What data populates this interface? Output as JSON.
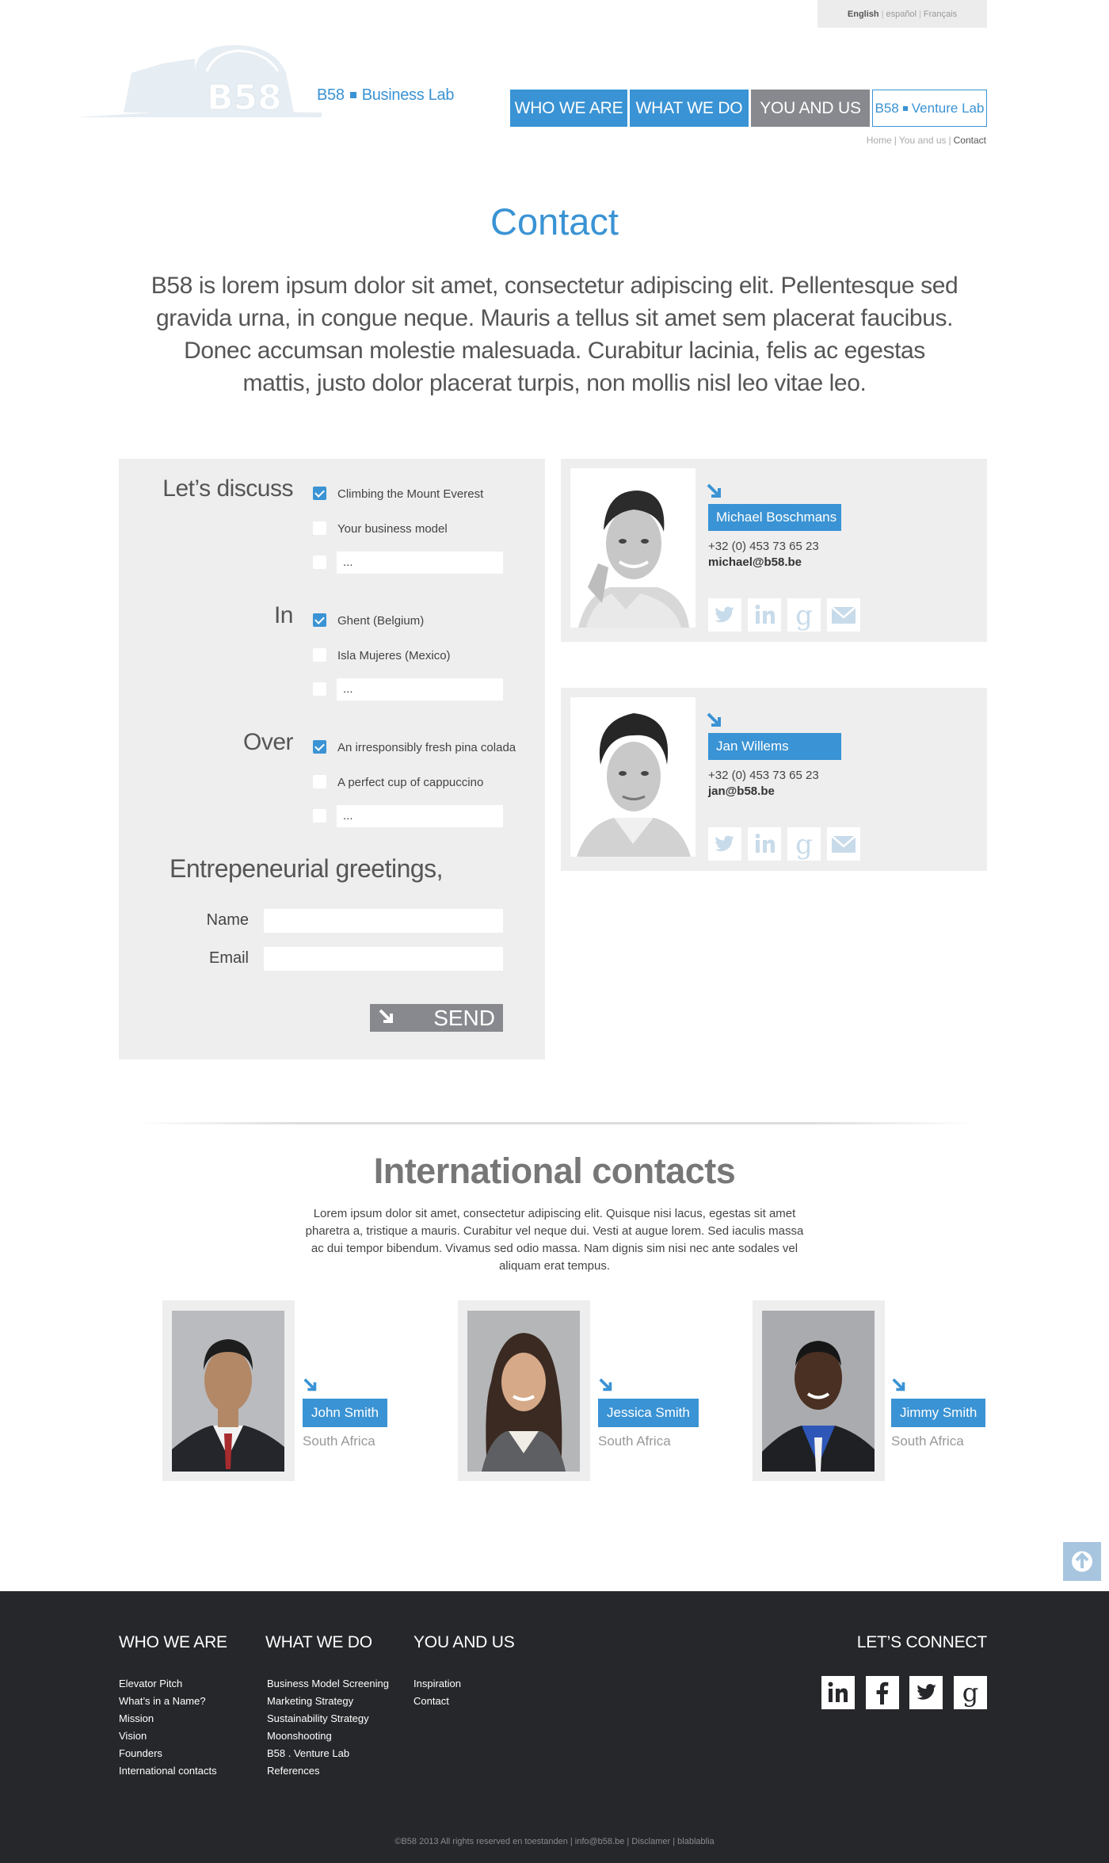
{
  "languages": {
    "current": "English",
    "other": [
      "español",
      "Français"
    ]
  },
  "logo": {
    "mark": "B58",
    "name": "B58",
    "suffix": "Business Lab"
  },
  "nav": {
    "items": [
      "WHO WE ARE",
      "WHAT WE DO",
      "YOU AND US"
    ],
    "active": "YOU AND US",
    "venture": {
      "name": "B58",
      "suffix": "Venture Lab"
    }
  },
  "breadcrumb": [
    "Home",
    "You and us",
    "Contact"
  ],
  "page": {
    "title": "Contact",
    "intro": "B58 is lorem ipsum dolor sit amet, consectetur adipiscing elit. Pellentesque sed gravida urna, in congue neque. Mauris a tellus sit amet sem placerat faucibus. Donec accumsan molestie malesuada. Curabitur lacinia, felis ac egestas mattis, justo dolor placerat turpis, non mollis nisl leo vitae leo."
  },
  "form": {
    "groups": [
      {
        "label": "Let’s discuss",
        "options": [
          {
            "text": "Climbing the Mount Everest",
            "checked": true
          },
          {
            "text": "Your business model",
            "checked": false
          }
        ],
        "custom": "..."
      },
      {
        "label": "In",
        "options": [
          {
            "text": "Ghent (Belgium)",
            "checked": true
          },
          {
            "text": "Isla Mujeres (Mexico)",
            "checked": false
          }
        ],
        "custom": "..."
      },
      {
        "label": "Over",
        "options": [
          {
            "text": "An irresponsibly fresh pina colada",
            "checked": true
          },
          {
            "text": "A perfect cup of cappuccino",
            "checked": false
          }
        ],
        "custom": "..."
      }
    ],
    "greeting": "Entrepeneurial greetings,",
    "name_label": "Name",
    "name_value": "",
    "email_label": "Email",
    "email_value": "",
    "send_label": "SEND"
  },
  "contacts": [
    {
      "name": "Michael Boschmans",
      "phone": "+32 (0) 453 73 65 23",
      "email": "michael@b58.be"
    },
    {
      "name": "Jan Willems",
      "phone": "+32 (0) 453 73 65 23",
      "email": "jan@b58.be"
    }
  ],
  "social_icons": [
    "twitter-icon",
    "linkedin-icon",
    "google-icon",
    "mail-icon"
  ],
  "international": {
    "title": "International contacts",
    "text": "Lorem ipsum dolor sit amet, consectetur adipiscing elit. Quisque nisi lacus, egestas sit amet pharetra a, tristique a mauris. Curabitur vel neque dui. Vesti at augue lorem. Sed iaculis massa ac dui tempor bibendum. Vivamus sed odio massa. Nam dignis sim nisi nec ante sodales vel aliquam erat tempus.",
    "people": [
      {
        "name": "John Smith",
        "country": "South Africa"
      },
      {
        "name": "Jessica Smith",
        "country": "South Africa"
      },
      {
        "name": "Jimmy Smith",
        "country": "South Africa"
      }
    ]
  },
  "footer": {
    "columns": [
      {
        "title": "WHO WE ARE",
        "links": [
          "Elevator Pitch",
          "What’s in a Name?",
          "Mission",
          "Vision",
          "Founders",
          "International contacts"
        ]
      },
      {
        "title": "WHAT WE DO",
        "links": [
          "Business Model Screening",
          "Marketing Strategy",
          "Sustainability Strategy",
          "Moonshooting",
          "B58 . Venture Lab",
          "References"
        ]
      },
      {
        "title": "YOU AND US",
        "links": [
          "Inspiration",
          "Contact"
        ]
      }
    ],
    "connect_title": "LET’S CONNECT",
    "social": [
      "linkedin-icon",
      "facebook-icon",
      "twitter-icon",
      "google-icon"
    ],
    "copyright": "©B58 2013 All rights reserved en toestanden | info@b58.be | Disclamer | blablablia"
  },
  "colors": {
    "accent": "#3a93d4",
    "nav_active": "#88898e",
    "panel": "#eeeeef",
    "footer": "#26272a"
  }
}
